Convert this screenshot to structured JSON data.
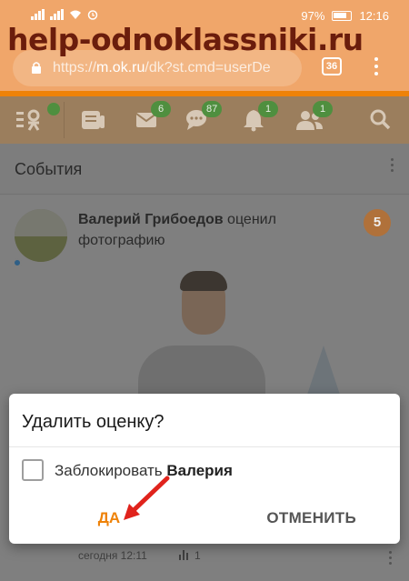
{
  "watermark": "help-odnoklassniki.ru",
  "status_bar": {
    "battery": "97%",
    "time": "12:16"
  },
  "browser": {
    "url_scheme": "https://",
    "url_host": "m.ok.ru",
    "url_rest": "/dk?st.cmd=userDe",
    "tab_count": "36"
  },
  "toolbar": {
    "icons": [
      {
        "name": "ok-menu-icon",
        "badge": ""
      },
      {
        "name": "feed-icon",
        "badge": ""
      },
      {
        "name": "messages-icon",
        "badge": "6"
      },
      {
        "name": "discussions-icon",
        "badge": "87"
      },
      {
        "name": "notifications-icon",
        "badge": "1"
      },
      {
        "name": "friends-icon",
        "badge": "1"
      },
      {
        "name": "search-icon",
        "badge": ""
      }
    ]
  },
  "events": {
    "title": "События",
    "item": {
      "author": "Валерий Грибоедов",
      "action": "оценил фотографию",
      "rating": "5",
      "time": "сегодня 12:11",
      "stat": "1"
    }
  },
  "dialog": {
    "title": "Удалить оценку?",
    "checkbox_label": "Заблокировать",
    "checkbox_name": "Валерия",
    "checked": false,
    "confirm": "ДА",
    "cancel": "ОТМЕНИТЬ"
  },
  "colors": {
    "accent": "#ee8208",
    "arrow": "#e0231c"
  }
}
